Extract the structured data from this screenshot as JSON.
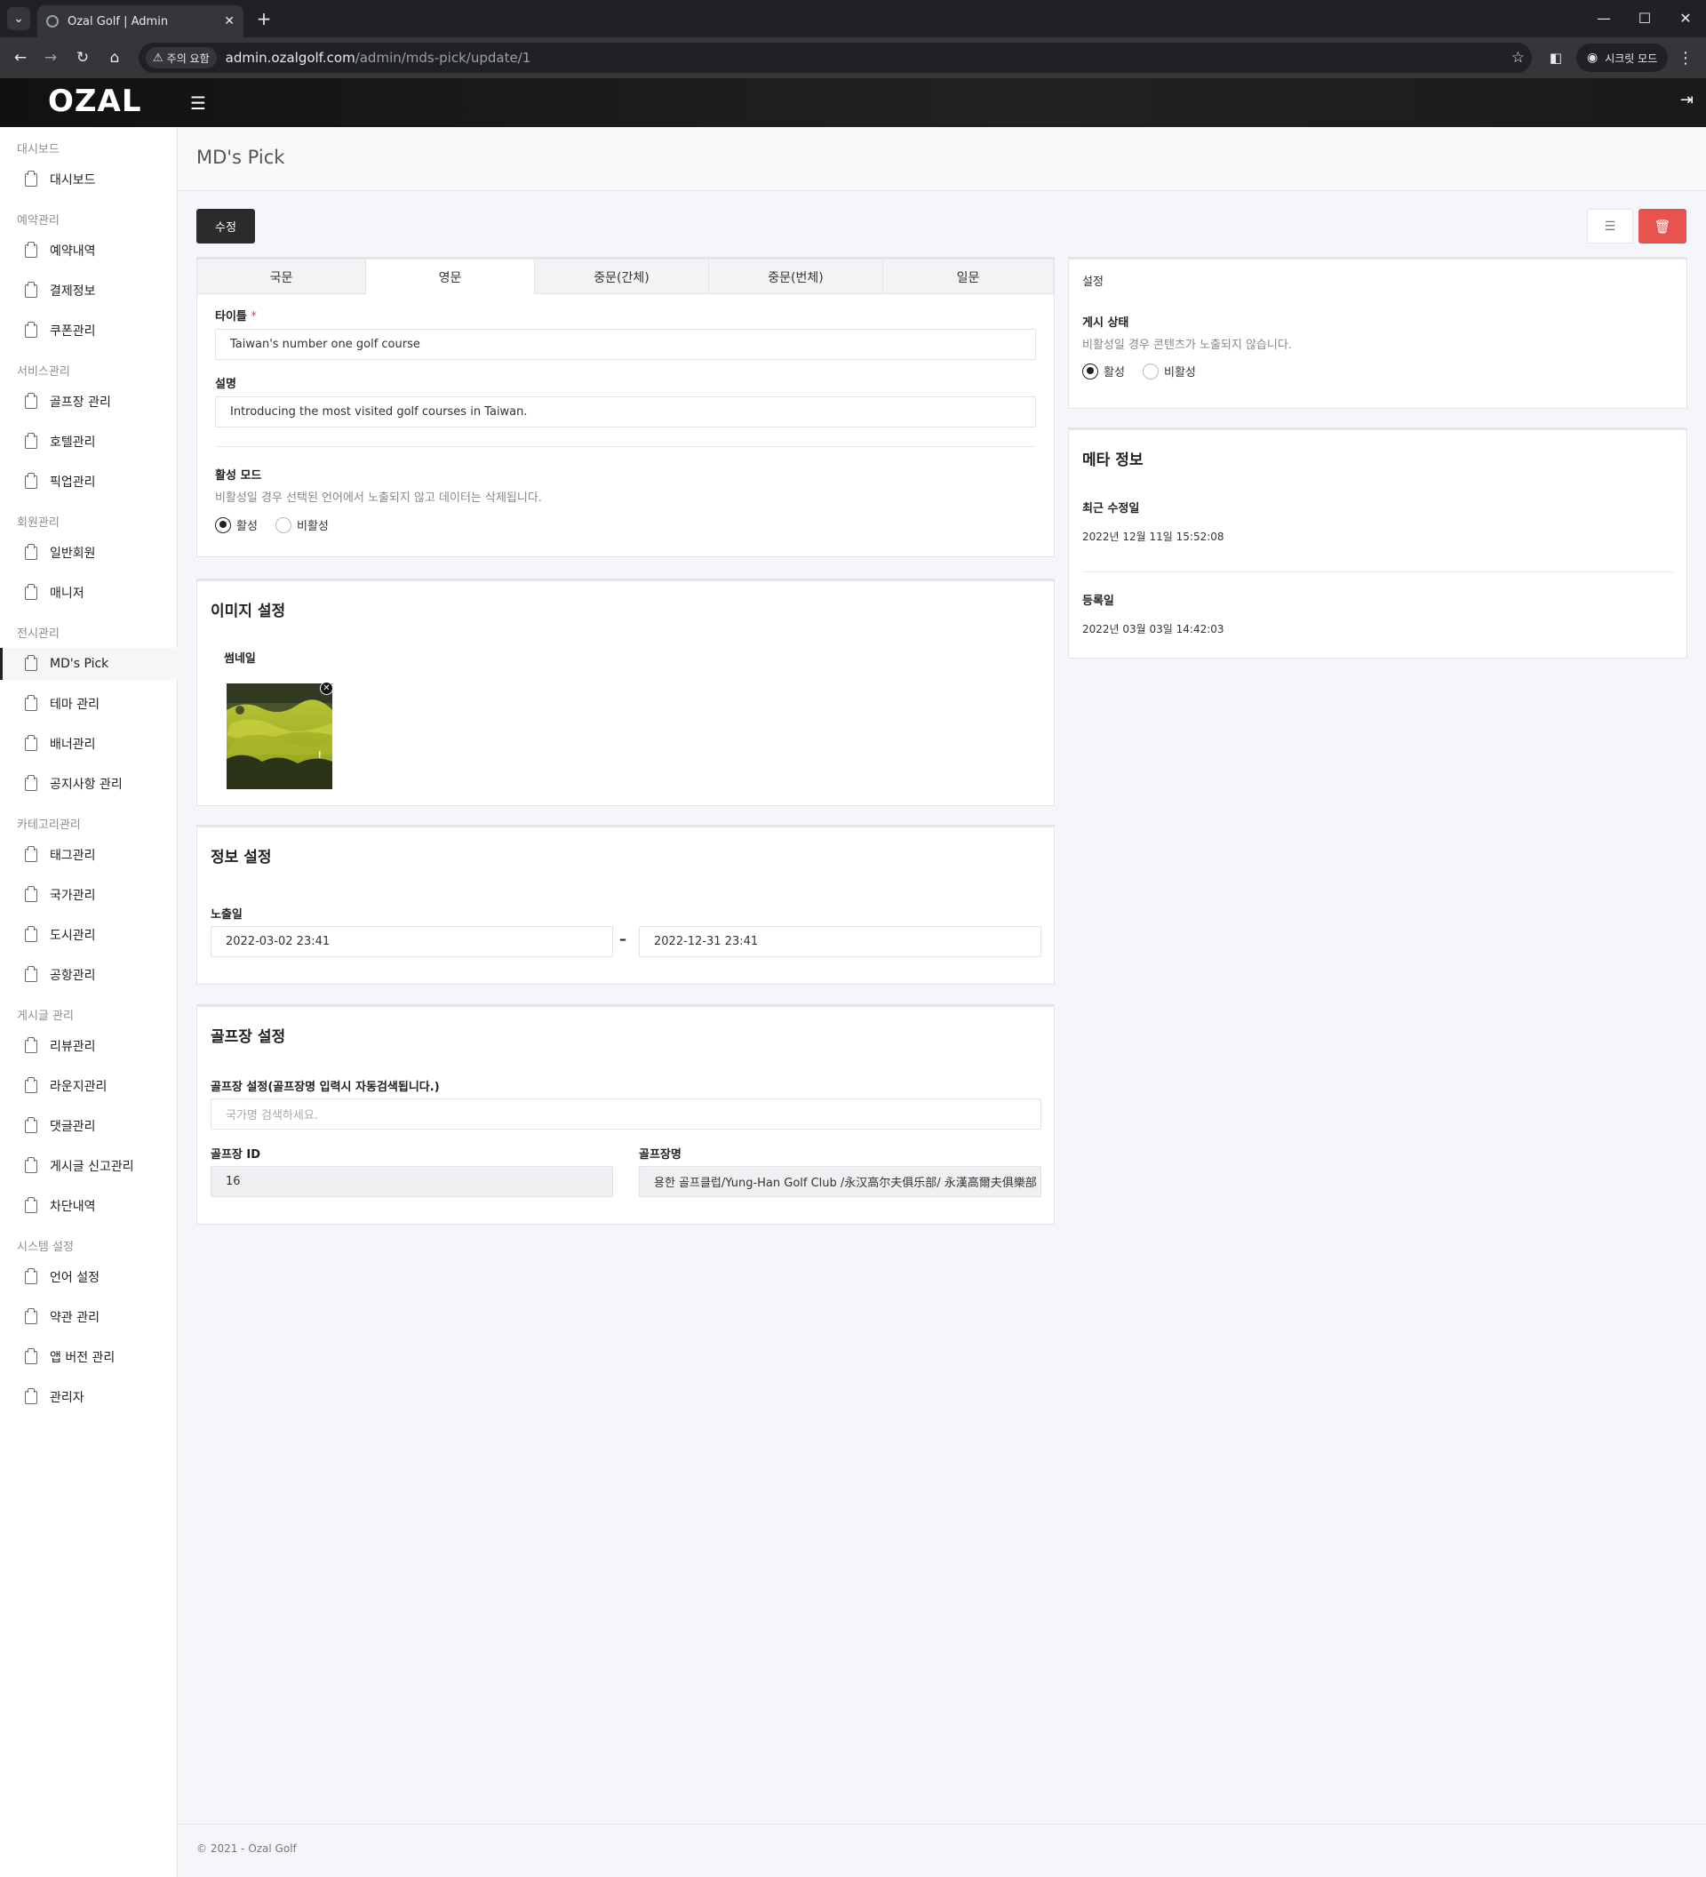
{
  "browser": {
    "tab_title": "Ozal Golf | Admin",
    "warning_chip": "주의 요함",
    "url_host": "admin.ozalgolf.com",
    "url_path": "/admin/mds-pick/update/1",
    "incognito_label": "시크릿 모드"
  },
  "header": {
    "logo": "OZAL"
  },
  "sidebar": {
    "sections": [
      {
        "label": "대시보드",
        "items": [
          "대시보드"
        ]
      },
      {
        "label": "예약관리",
        "items": [
          "예약내역",
          "결제정보",
          "쿠폰관리"
        ]
      },
      {
        "label": "서비스관리",
        "items": [
          "골프장 관리",
          "호텔관리",
          "픽업관리"
        ]
      },
      {
        "label": "회원관리",
        "items": [
          "일반회원",
          "매니저"
        ]
      },
      {
        "label": "전시관리",
        "items": [
          "MD's Pick",
          "테마 관리",
          "배너관리",
          "공지사항 관리"
        ]
      },
      {
        "label": "카테고리관리",
        "items": [
          "태그관리",
          "국가관리",
          "도시관리",
          "공항관리"
        ]
      },
      {
        "label": "게시글 관리",
        "items": [
          "리뷰관리",
          "라운지관리",
          "댓글관리",
          "게시글 신고관리",
          "차단내역"
        ]
      },
      {
        "label": "시스템 설정",
        "items": [
          "언어 설정",
          "약관 관리",
          "앱 버전 관리",
          "관리자"
        ]
      }
    ],
    "active_item": "MD's Pick"
  },
  "page": {
    "title": "MD's Pick",
    "edit_button": "수정"
  },
  "lang_tabs": [
    "국문",
    "영문",
    "중문(간체)",
    "중문(번체)",
    "일문"
  ],
  "active_tab": "영문",
  "content_form": {
    "title_label": "타이틀",
    "title_required": "*",
    "title_value": "Taiwan's number one golf course",
    "desc_label": "설명",
    "desc_value": "Introducing the most visited golf courses in Taiwan.",
    "mode_label": "활성 모드",
    "mode_help": "비활성일 경우 선택된 언어에서 노출되지 않고 데이터는 삭제됩니다.",
    "active_label": "활성",
    "inactive_label": "비활성"
  },
  "image_settings": {
    "title": "이미지 설정",
    "thumbnail_label": "썸네일"
  },
  "info_settings": {
    "title": "정보 설정",
    "display_label": "노출일",
    "start": "2022-03-02 23:41",
    "separator": "–",
    "end": "2022-12-31 23:41"
  },
  "golf_settings": {
    "title": "골프장 설정",
    "search_label": "골프장 설정(골프장명 입력시 자동검색됩니다.)",
    "search_placeholder": "국가명 검색하세요.",
    "id_label": "골프장 ID",
    "id_value": "16",
    "name_label": "골프장명",
    "name_value": "용한 골프클럽/Yung-Han Golf Club /永汉高尔夫俱乐部/ 永漢高爾夫俱樂部"
  },
  "settings": {
    "title": "설정",
    "status_label": "게시 상태",
    "status_help": "비활성일 경우 콘텐츠가 노출되지 않습니다.",
    "active_label": "활성",
    "inactive_label": "비활성"
  },
  "meta": {
    "title": "메타 정보",
    "modified_label": "최근 수정일",
    "modified_value": "2022년 12월 11일 15:52:08",
    "created_label": "등록일",
    "created_value": "2022년 03월 03일 14:42:03"
  },
  "footer": {
    "text": "© 2021 - Ozal Golf"
  },
  "colors": {
    "dark_button": "#2b2b2b",
    "delete_button": "#e8524f",
    "header_bg": "#111111"
  }
}
